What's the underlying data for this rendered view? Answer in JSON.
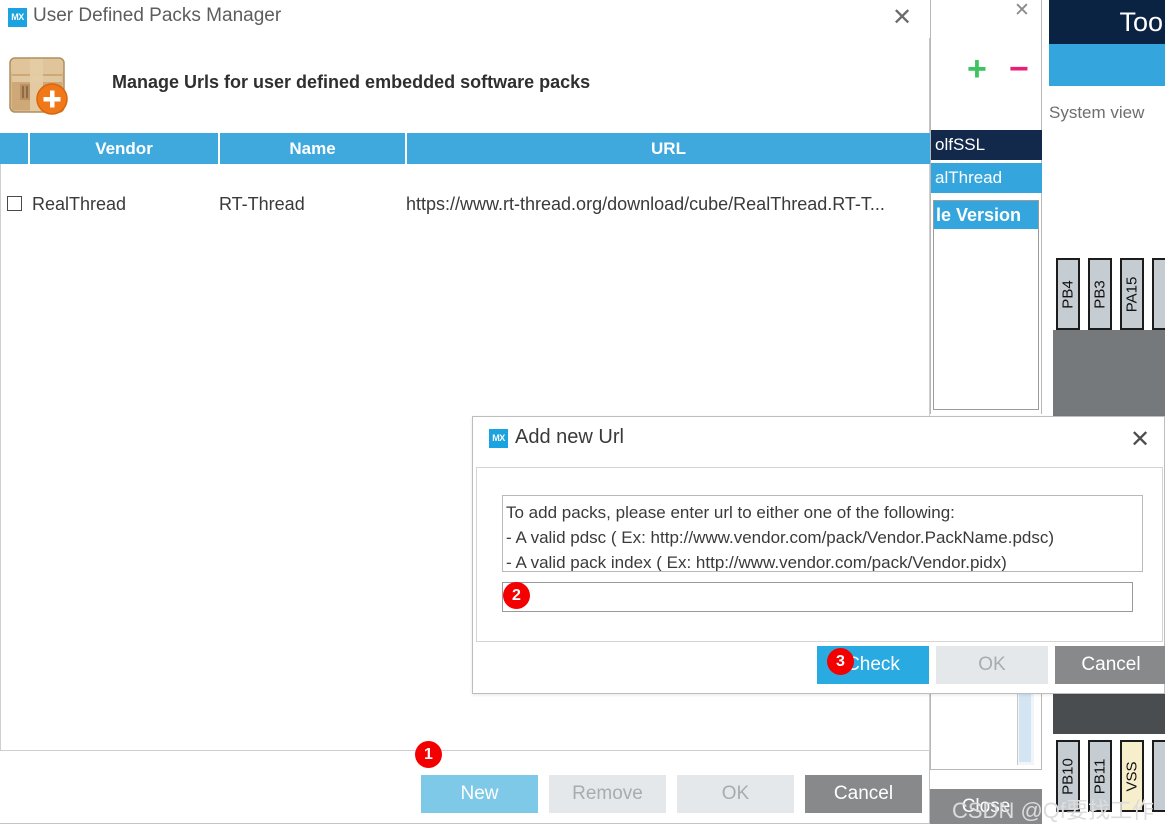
{
  "background": {
    "toolbar_label": "Too",
    "system_view_label": "System view",
    "pack_panel": {
      "close_icon": "close-icon",
      "add_icon": "plus-icon",
      "remove_icon": "minus-icon",
      "rows": [
        {
          "label": "olfSSL",
          "state": "selected-dark"
        },
        {
          "label": "alThread",
          "state": "selected-blue"
        }
      ],
      "sub_panel_header": "le Version"
    },
    "close_button": "Close",
    "pins_top": [
      "PB4",
      "PB3",
      "PA15"
    ],
    "pins_bottom": [
      "PB10",
      "PB11",
      "VSS"
    ]
  },
  "packs_dialog": {
    "title": "User Defined Packs Manager",
    "title_badge": "MX",
    "close_icon": "close-icon",
    "header_icon": "package-add-icon",
    "header_text": "Manage Urls for user defined embedded software packs",
    "table": {
      "columns": [
        "",
        "Vendor",
        "Name",
        "URL"
      ],
      "rows": [
        {
          "checked": false,
          "vendor": "RealThread",
          "name": "RT-Thread",
          "url": "https://www.rt-thread.org/download/cube/RealThread.RT-T..."
        }
      ]
    },
    "buttons": {
      "new": "New",
      "remove": "Remove",
      "ok": "OK",
      "cancel": "Cancel"
    }
  },
  "add_url_dialog": {
    "title": "Add new Url",
    "title_badge": "MX",
    "close_icon": "close-icon",
    "help_lines": [
      "To add packs, please enter url to either one of the following:",
      "- A valid pdsc ( Ex: http://www.vendor.com/pack/Vendor.PackName.pdsc)",
      "- A valid pack index ( Ex: http://www.vendor.com/pack/Vendor.pidx)"
    ],
    "url_input": {
      "value": "",
      "placeholder": ""
    },
    "buttons": {
      "check": "Check",
      "ok": "OK",
      "cancel": "Cancel"
    }
  },
  "annotations": {
    "step1": "1",
    "step2": "2",
    "step3": "3"
  },
  "watermark": "CSDN @Qf要找工作",
  "colors": {
    "accent_blue": "#29abe2",
    "header_blue": "#3fa9dd",
    "light_blue": "#7ec9e8",
    "dark_navy": "#0b2343",
    "grey_button": "#87898b",
    "disabled_button": "#e4e8eb",
    "badge_red": "#f40000",
    "plus_green": "#3dc35f",
    "minus_pink": "#e81f78"
  }
}
